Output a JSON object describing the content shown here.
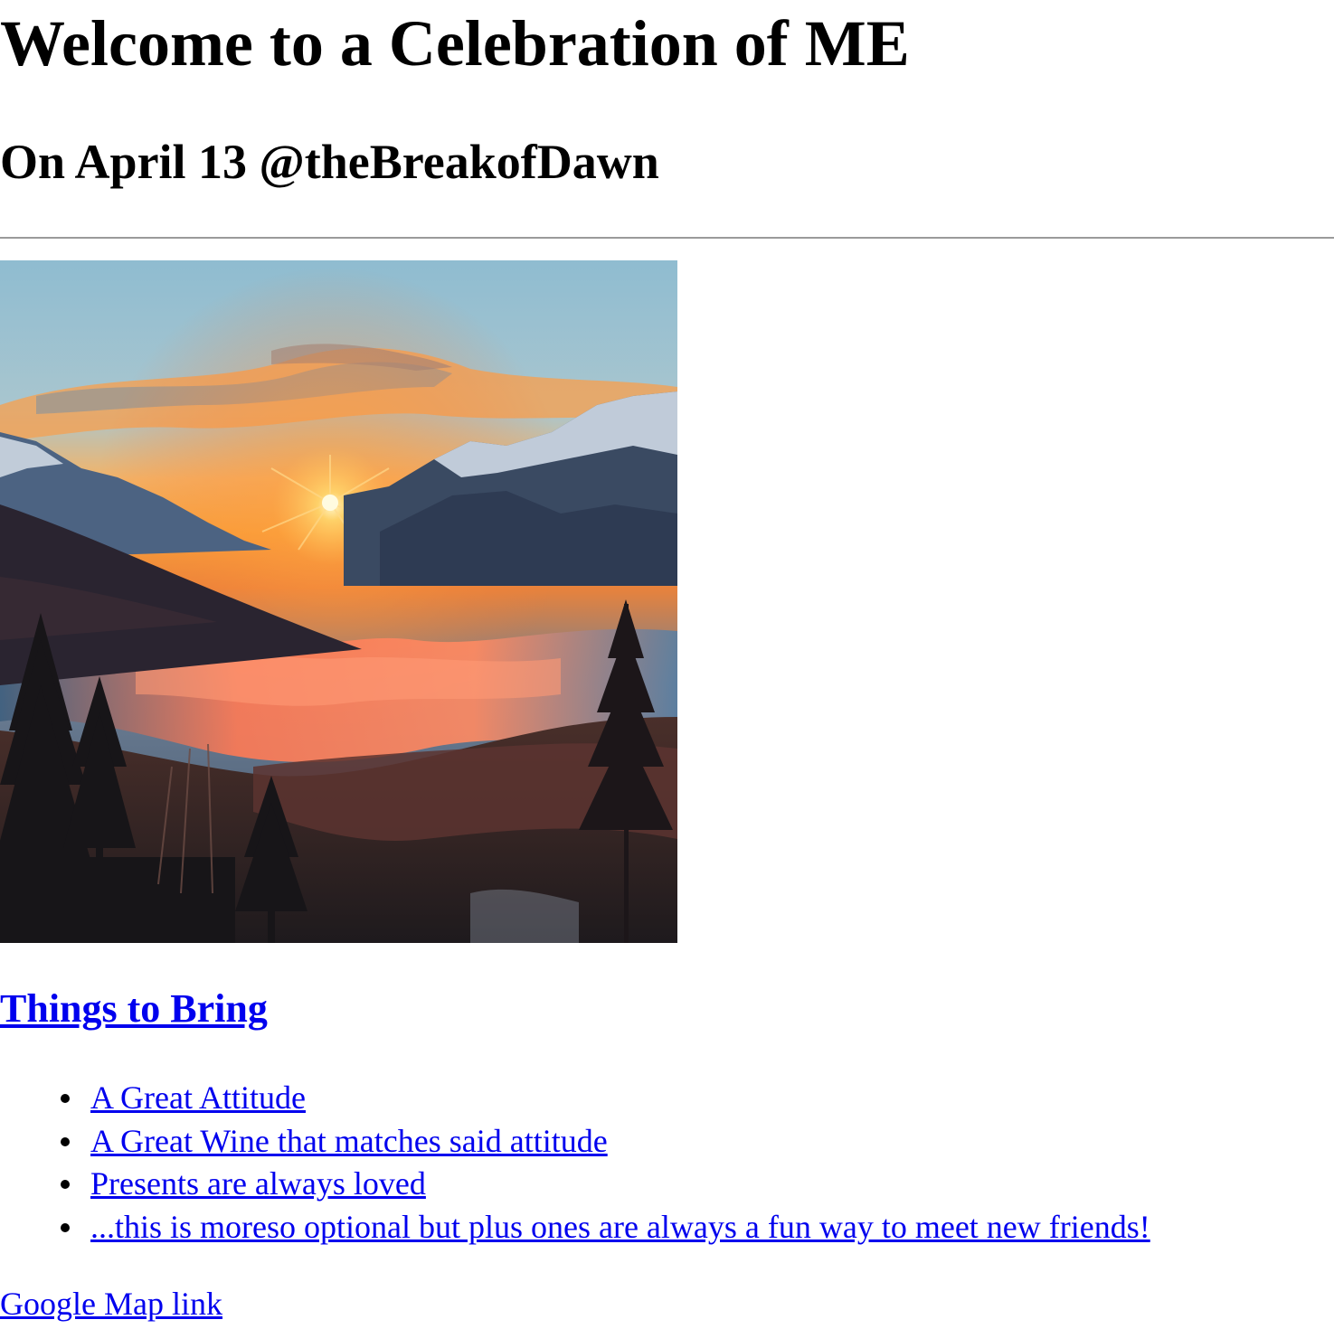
{
  "header": {
    "title": "Welcome to a Celebration of ME",
    "subtitle": "On April 13 @theBreakofDawn"
  },
  "hero_image": {
    "alt": "Sunrise over mountains with misty valley and pine forest",
    "icon": "sunrise-mountain-image"
  },
  "bring_section": {
    "heading": "Things to Bring",
    "items": [
      {
        "label": "A Great Attitude"
      },
      {
        "label": "A Great Wine that matches said attitude"
      },
      {
        "label": "Presents are always loved"
      },
      {
        "label": "...this is moreso optional but plus ones are always a fun way to meet new friends!"
      }
    ]
  },
  "footer": {
    "map_link": "Google Map link"
  },
  "colors": {
    "link": "#0000ee",
    "text": "#000000",
    "rule": "#9a9a9a"
  }
}
